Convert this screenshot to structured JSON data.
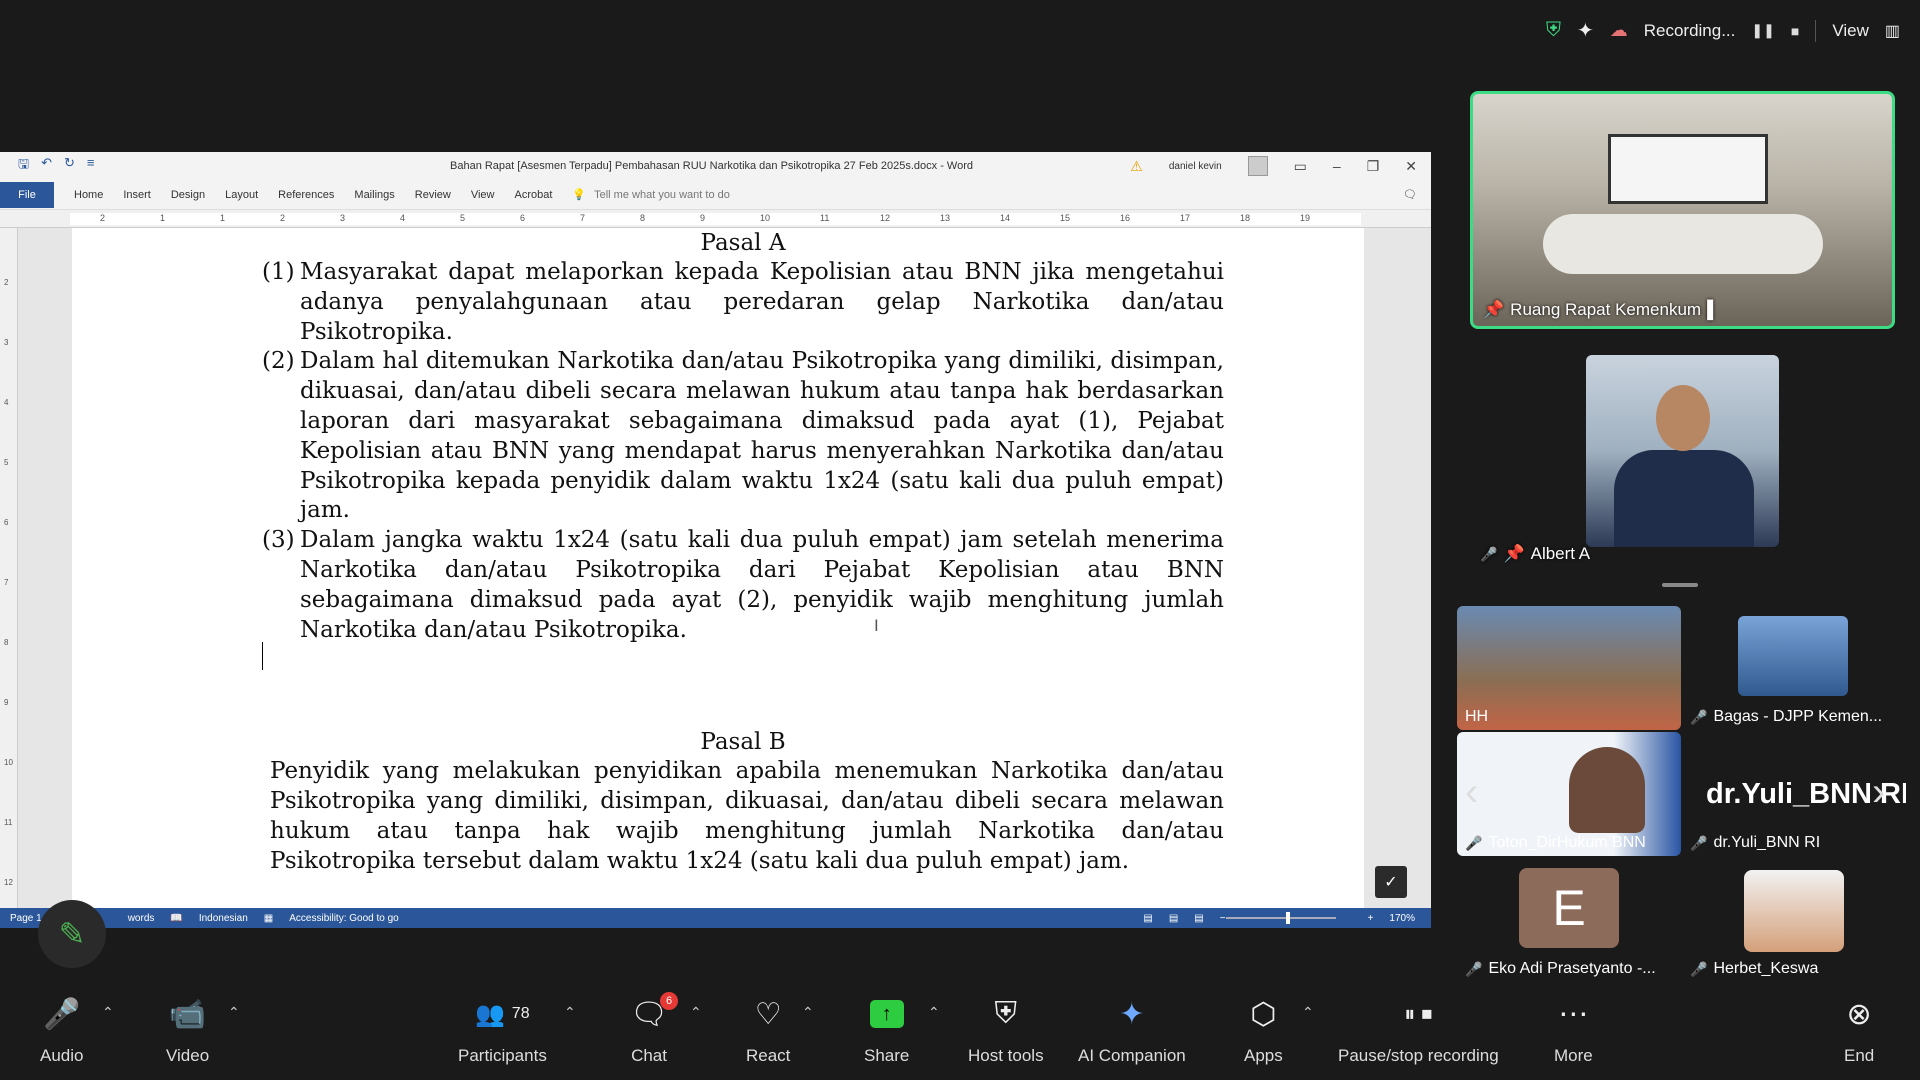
{
  "top_bar": {
    "recording_label": "Recording...",
    "view_label": "View"
  },
  "word": {
    "doc_title": "Bahan Rapat [Asesmen Terpadu] Pembahasan RUU Narkotika dan Psikotropika 27 Feb 2025s.docx  -  Word",
    "user_name": "daniel kevin",
    "ribbon_tabs": [
      "Home",
      "Insert",
      "Design",
      "Layout",
      "References",
      "Mailings",
      "Review",
      "View",
      "Acrobat"
    ],
    "file_tab": "File",
    "tell_me": "Tell me what you want to do",
    "ruler_numbers": [
      "2",
      "1",
      "1",
      "2",
      "3",
      "4",
      "5",
      "6",
      "7",
      "8",
      "9",
      "10",
      "11",
      "12",
      "13",
      "14",
      "15",
      "16",
      "17",
      "18",
      "19"
    ],
    "vruler_numbers": [
      "2",
      "3",
      "4",
      "5",
      "6",
      "7",
      "8",
      "9",
      "10",
      "11",
      "12"
    ],
    "document": {
      "heading_a": "Pasal A",
      "para1_num": "(1)",
      "para1": "Masyarakat dapat melaporkan kepada Kepolisian atau BNN jika mengetahui adanya penyalahgunaan atau peredaran gelap Narkotika dan/atau Psikotropika.",
      "para2_num": "(2)",
      "para2": "Dalam hal ditemukan Narkotika dan/atau Psikotropika yang dimiliki, disimpan, dikuasai, dan/atau dibeli secara melawan hukum atau tanpa hak berdasarkan laporan dari masyarakat sebagaimana dimaksud pada ayat (1), Pejabat Kepolisian atau BNN yang mendapat harus menyerahkan Narkotika dan/atau Psikotropika kepada penyidik dalam waktu 1x24 (satu kali dua puluh empat) jam.",
      "para3_num": "(3)",
      "para3": "Dalam jangka waktu 1x24 (satu kali dua puluh empat) jam setelah menerima Narkotika dan/atau Psikotropika dari Pejabat Kepolisian atau BNN sebagaimana dimaksud pada ayat (2), penyidik wajib menghitung jumlah Narkotika dan/atau Psikotropika.",
      "heading_b": "Pasal B",
      "para_b": "Penyidik yang melakukan penyidikan apabila menemukan Narkotika dan/atau Psikotropika yang dimiliki, disimpan, dikuasai, dan/atau dibeli secara melawan hukum atau tanpa hak wajib menghitung jumlah Narkotika dan/atau Psikotropika tersebut dalam waktu 1x24 (satu kali dua puluh empat) jam."
    },
    "status": {
      "page": "Page 1",
      "words": "words",
      "language": "Indonesian",
      "accessibility": "Accessibility: Good to go",
      "zoom": "170%"
    }
  },
  "participants_video": {
    "main": "Ruang Rapat Kemenkum",
    "second": "Albert A",
    "tiles": [
      "HH",
      "Bagas - DJPP Kemen...",
      "Toton_DirHukum BNN",
      "dr.Yuli_BNN RI",
      "Eko Adi Prasetyanto -...",
      "Herbet_Keswa"
    ],
    "big_name": "dr.Yuli_BNN RI",
    "avatar_letter": "E"
  },
  "toolbar": {
    "audio": "Audio",
    "video": "Video",
    "participants": "Participants",
    "participants_count": "78",
    "chat": "Chat",
    "chat_badge": "6",
    "react": "React",
    "share": "Share",
    "host_tools": "Host tools",
    "ai_companion": "AI Companion",
    "apps": "Apps",
    "pause_recording": "Pause/stop recording",
    "more": "More",
    "end": "End"
  },
  "colors": {
    "accent_green": "#3ddc84",
    "word_blue": "#2b579a",
    "end_red": "#e53935"
  }
}
